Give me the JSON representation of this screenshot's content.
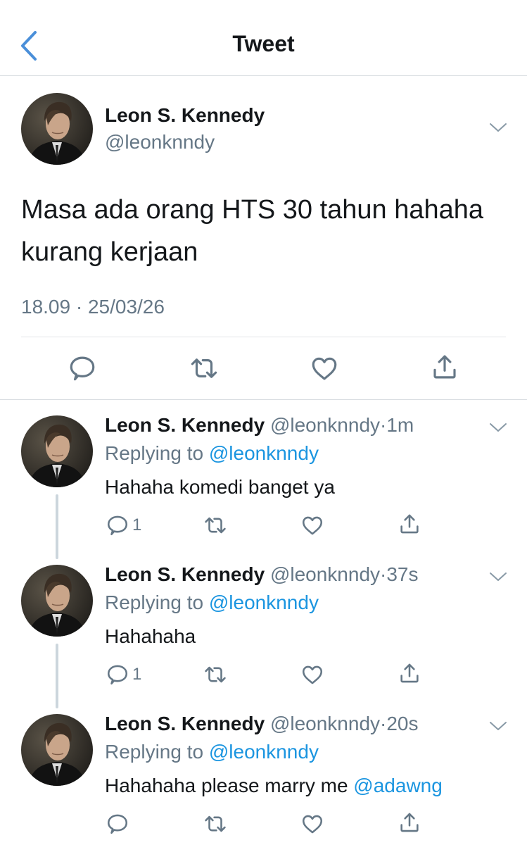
{
  "header": {
    "title": "Tweet"
  },
  "main_tweet": {
    "name": "Leon S. Kennedy",
    "handle": "@leonknndy",
    "text": "Masa ada orang HTS 30 tahun hahaha kurang kerjaan",
    "timestamp": "18.09 · 25/03/26"
  },
  "replies": [
    {
      "name": "Leon S. Kennedy",
      "handle": "@leonknndy",
      "dot": "·",
      "time": "1m",
      "replying_label": "Replying to",
      "replying_handle": "@leonknndy",
      "text": "Hahaha komedi banget ya",
      "text_mention": "",
      "reply_count": "1"
    },
    {
      "name": "Leon S. Kennedy",
      "handle": "@leonknndy",
      "dot": "·",
      "time": "37s",
      "replying_label": "Replying to",
      "replying_handle": "@leonknndy",
      "text": "Hahahaha",
      "text_mention": "",
      "reply_count": "1"
    },
    {
      "name": "Leon S. Kennedy",
      "handle": "@leonknndy",
      "dot": "·",
      "time": "20s",
      "replying_label": "Replying to",
      "replying_handle": "@leonknndy",
      "text": "Hahahaha please marry me",
      "text_mention": "@adawng",
      "reply_count": ""
    }
  ],
  "icons": {
    "back": "chevron-left-icon",
    "more": "chevron-down-icon",
    "reply": "comment-bubble-icon",
    "retweet": "retweet-arrows-icon",
    "like": "heart-icon",
    "share": "share-upload-icon"
  },
  "colors": {
    "link": "#1b95e0",
    "muted": "#657786",
    "text": "#14171a",
    "divider": "#d9dde1",
    "back": "#4a8fd9"
  }
}
